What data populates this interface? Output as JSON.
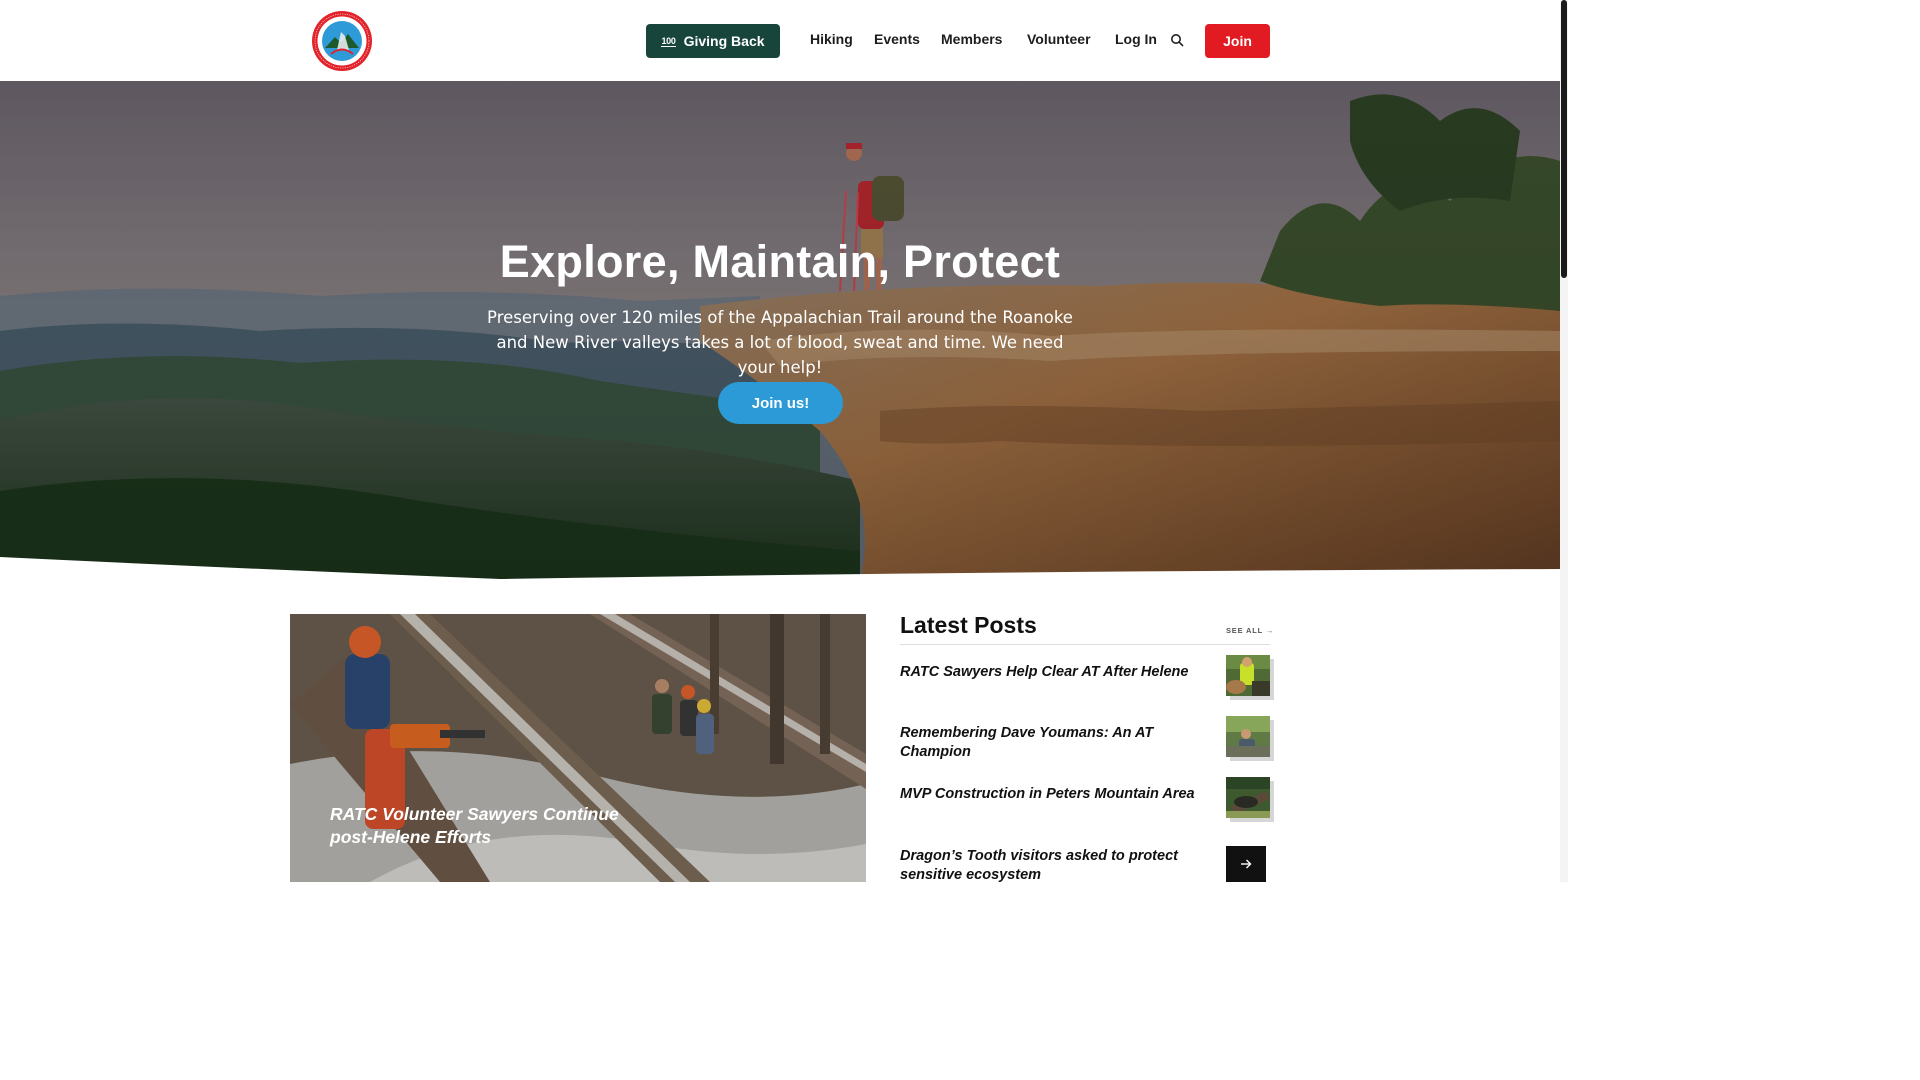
{
  "header": {
    "logo_alt": "Roanoke Appalachian Trail Club Virginia",
    "giving_back_label": "Giving Back",
    "giving_badge": "100",
    "nav": [
      {
        "label": "Hiking"
      },
      {
        "label": "Events"
      },
      {
        "label": "Members"
      },
      {
        "label": "Volunteer"
      },
      {
        "label": "Log In"
      }
    ],
    "search_icon": "search-icon",
    "join_label": "Join"
  },
  "hero": {
    "title": "Explore, Maintain, Protect",
    "subtitle": "Preserving over 120 miles of the Appalachian Trail around the Roanoke and New River valleys takes a lot of blood, sweat and time. We need your help!",
    "cta_label": "Join us!"
  },
  "featured": {
    "title": "RATC Volunteer Sawyers Continue post-Helene Efforts"
  },
  "latest_posts": {
    "heading": "Latest Posts",
    "see_all_label": "SEE ALL",
    "items": [
      {
        "title": "RATC Sawyers Help Clear AT After Helene"
      },
      {
        "title": "Remembering Dave Youmans: An AT Champion"
      },
      {
        "title": "MVP Construction in Peters Mountain Area"
      },
      {
        "title": "Dragon’s Tooth visitors asked to protect sensitive ecosystem"
      }
    ]
  },
  "colors": {
    "giving_back_bg": "#17443b",
    "join_bg": "#e21b23",
    "cta_bg": "#2b9ad6"
  }
}
